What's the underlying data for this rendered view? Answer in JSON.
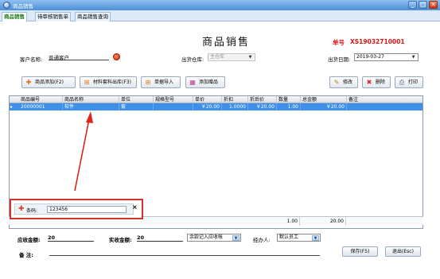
{
  "window": {
    "title": "商品销售",
    "min": "_",
    "max": "□",
    "close": "✕"
  },
  "tabs": [
    "商品销售",
    "待审核销售单",
    "商品销售查询"
  ],
  "form": {
    "heading": "商品销售",
    "order_label": "单号",
    "order_no": "XS19032710001",
    "customer_label": "客户名称:",
    "customer_value": "普通客户",
    "warehouse_label": "出货仓库:",
    "warehouse_value": "主仓库",
    "date_label": "出货日期:",
    "date_value": "2019-03-27"
  },
  "toolbar": {
    "add": "商品添加(F2)",
    "material": "材料套料出库(F3)",
    "import": "单据导入",
    "add_gift": "添加赠品",
    "edit": "修改",
    "delete": "删除",
    "print": "打印"
  },
  "grid": {
    "columns": [
      "商品编号",
      "商品名称",
      "单位",
      "规格型号",
      "单价",
      "折扣",
      "折后价",
      "数量",
      "总金额",
      "备注"
    ],
    "rows": [
      {
        "code": "20000001",
        "name": "软件",
        "unit": "套",
        "spec": "",
        "price": "￥20.00",
        "discount": "1.0000",
        "after": "￥20.00",
        "qty": "1.00",
        "total": "￥20.00",
        "note": ""
      }
    ],
    "totals": {
      "qty": "1.00",
      "total": "20.00"
    }
  },
  "barcode": {
    "label": "条码:",
    "value": "123456",
    "close": "×"
  },
  "footer": {
    "receivable_label": "应收金额:",
    "receivable_value": "20",
    "received_label": "实收金额:",
    "received_value": "20",
    "account_option": "余款记入应收帐",
    "handler_label": "经办人:",
    "handler_value": "默认员工",
    "note_label": "备    注:",
    "save": "保存(F5)",
    "exit": "退出(Esc)"
  },
  "colors": {
    "title_accent": "#4d8fd8",
    "order_red": "#e01010",
    "selected_row": "#3d8fe8",
    "highlight_red": "#d9322e"
  }
}
